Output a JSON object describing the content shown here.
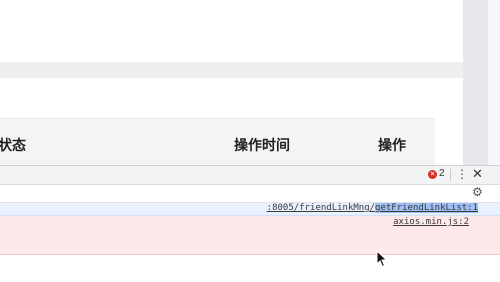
{
  "table": {
    "headers": {
      "status": "状态",
      "time": "操作时间",
      "ops": "操作"
    }
  },
  "devtools": {
    "error_count": "2",
    "error_icon_glyph": "×",
    "kebab_glyph": "⋮",
    "close_glyph": "✕",
    "settings_glyph": "⚙",
    "rows": [
      {
        "source_prefix": ":8005/friendLinkMng/",
        "source_highlight": "getFriendLinkList:1"
      },
      {
        "source": "axios.min.js:2"
      }
    ]
  },
  "colors": {
    "error_red": "#d93025",
    "info_row_bg": "#e8f0fe",
    "error_row_bg": "#fde8ea"
  }
}
